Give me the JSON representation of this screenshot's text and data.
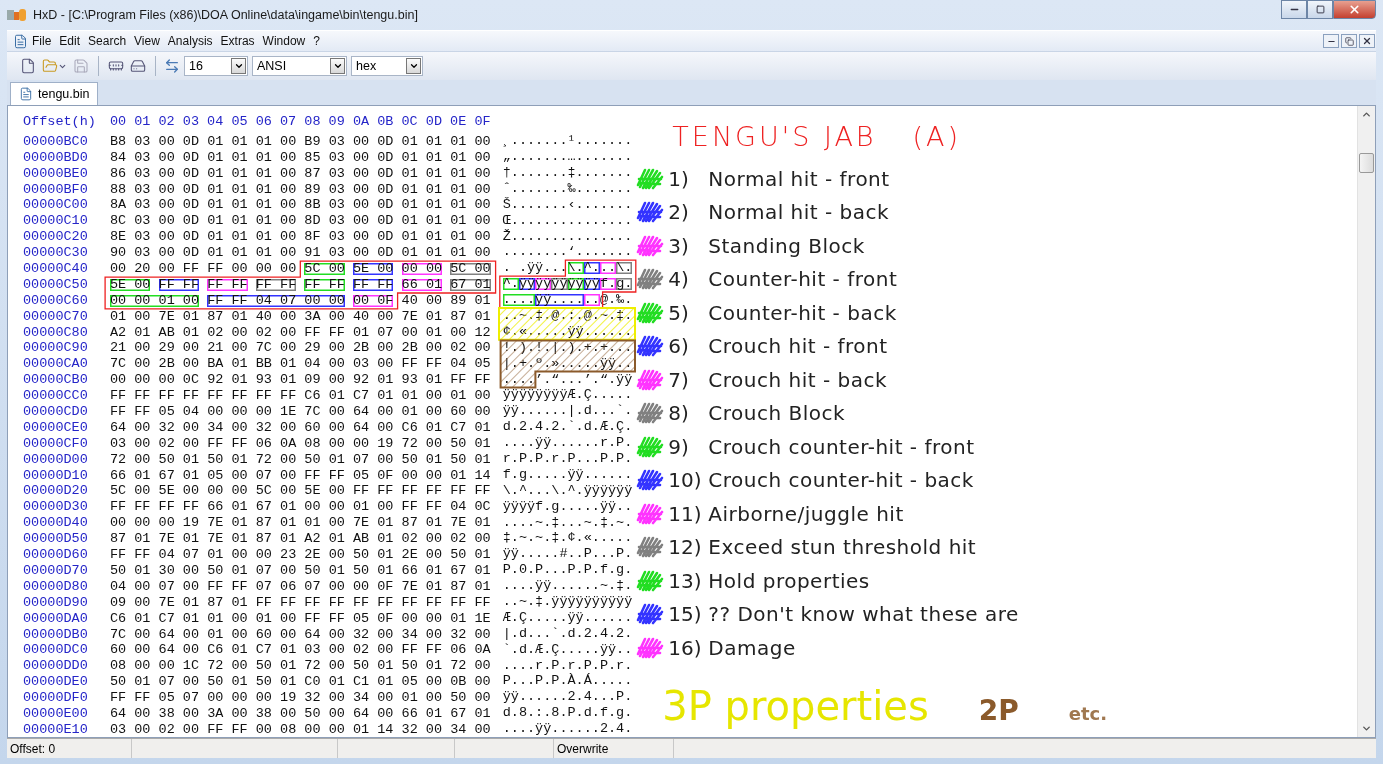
{
  "window": {
    "title": "HxD - [C:\\Program Files (x86)\\DOA Online\\data\\ingame\\bin\\tengu.bin]"
  },
  "menu": [
    "File",
    "Edit",
    "Search",
    "View",
    "Analysis",
    "Extras",
    "Window",
    "?"
  ],
  "toolbar": {
    "bytes_per_row": "16",
    "charset": "ANSI",
    "offset_base": "hex"
  },
  "tabs": [
    {
      "label": "tengu.bin",
      "selected": true
    }
  ],
  "editor": {
    "offset_header": "Offset(h)",
    "column_headers": [
      "00",
      "01",
      "02",
      "03",
      "04",
      "05",
      "06",
      "07",
      "08",
      "09",
      "0A",
      "0B",
      "0C",
      "0D",
      "0E",
      "0F"
    ],
    "rows": [
      {
        "offset": "00000BC0",
        "hex": [
          {
            "text": "B8 03 00 0D 01 01 01 00 B9 03 00 0D 01 01 01 00"
          }
        ],
        "ansi": [
          {
            "text": "¸.......¹......."
          }
        ]
      },
      {
        "offset": "00000BD0",
        "hex": [
          {
            "text": "84 03 00 0D 01 01 01 00 85 03 00 0D 01 01 01 00"
          }
        ],
        "ansi": [
          {
            "text": "„.......…......."
          }
        ]
      },
      {
        "offset": "00000BE0",
        "hex": [
          {
            "text": "86 03 00 0D 01 01 01 00 87 03 00 0D 01 01 01 00"
          }
        ],
        "ansi": [
          {
            "text": "†.......‡......."
          }
        ]
      },
      {
        "offset": "00000BF0",
        "hex": [
          {
            "text": "88 03 00 0D 01 01 01 00 89 03 00 0D 01 01 01 00"
          }
        ],
        "ansi": [
          {
            "text": "ˆ.......‰......."
          }
        ]
      },
      {
        "offset": "00000C00",
        "hex": [
          {
            "text": "8A 03 00 0D 01 01 01 00 8B 03 00 0D 01 01 01 00"
          }
        ],
        "ansi": [
          {
            "text": "Š.......‹......."
          }
        ]
      },
      {
        "offset": "00000C10",
        "hex": [
          {
            "text": "8C 03 00 0D 01 01 01 00 8D 03 00 0D 01 01 01 00"
          }
        ],
        "ansi": [
          {
            "text": "Œ..............."
          }
        ]
      },
      {
        "offset": "00000C20",
        "hex": [
          {
            "text": "8E 03 00 0D 01 01 01 00 8F 03 00 0D 01 01 01 00"
          }
        ],
        "ansi": [
          {
            "text": "Ž..............."
          }
        ]
      },
      {
        "offset": "00000C30",
        "hex": [
          {
            "text": "90 03 00 0D 01 01 01 00 91 03 00 0D 01 01 01 00"
          }
        ],
        "ansi": [
          {
            "text": "........‘......."
          }
        ]
      },
      {
        "offset": "00000C40",
        "hex": [
          {
            "text": "00 20 00 FF FF 00 00 00"
          },
          {
            "text": "5C 00",
            "color": "#22dd22"
          },
          {
            "text": "5E 00",
            "color": "#3333ff"
          },
          {
            "text": "00 00",
            "color": "#ff33ff"
          },
          {
            "text": "5C 00",
            "color": "#808080"
          }
        ],
        "ansi": [
          {
            "text": ". .ÿÿ..."
          },
          {
            "text": "\\.",
            "color": "#22dd22"
          },
          {
            "text": "^.",
            "color": "#3333ff"
          },
          {
            "text": "..",
            "color": "#ff33ff"
          },
          {
            "text": "\\.",
            "color": "#808080"
          }
        ]
      },
      {
        "offset": "00000C50",
        "hex": [
          {
            "text": "5E 00",
            "color": "#22dd22"
          },
          {
            "text": "FF FF",
            "color": "#3333ff"
          },
          {
            "text": "FF FF",
            "color": "#ff33ff"
          },
          {
            "text": "FF FF",
            "color": "#808080"
          },
          {
            "text": "FF FF",
            "color": "#22dd22"
          },
          {
            "text": "FF FF",
            "color": "#3333ff"
          },
          {
            "text": "66 01",
            "color": "#ff33ff"
          },
          {
            "text": "67 01",
            "color": "#808080"
          }
        ],
        "ansi": [
          {
            "text": "^.",
            "color": "#22dd22"
          },
          {
            "text": "ÿÿ",
            "color": "#3333ff"
          },
          {
            "text": "ÿÿ",
            "color": "#ff33ff"
          },
          {
            "text": "ÿÿ",
            "color": "#808080"
          },
          {
            "text": "ÿÿ",
            "color": "#22dd22"
          },
          {
            "text": "ÿÿ",
            "color": "#3333ff"
          },
          {
            "text": "f.",
            "color": "#ff33ff"
          },
          {
            "text": "g.",
            "color": "#808080"
          }
        ]
      },
      {
        "offset": "00000C60",
        "hex": [
          {
            "text": "00 00 01 00",
            "color": "#22dd22"
          },
          {
            "text": "FF FF 04 07 00 00",
            "color": "#3333ff"
          },
          {
            "text": "00 0F",
            "color": "#ff33ff"
          },
          {
            "text": "40 00 89 01"
          }
        ],
        "ansi": [
          {
            "text": "....",
            "color": "#22dd22"
          },
          {
            "text": "ÿÿ....",
            "color": "#3333ff"
          },
          {
            "text": "..",
            "color": "#ff33ff"
          },
          {
            "text": "@.‰."
          }
        ]
      },
      {
        "offset": "00000C70",
        "hex": [
          {
            "text": "01 00 7E 01 87 01 40 00 3A 00 40 00 7E 01 87 01"
          }
        ],
        "ansi": [
          {
            "text": "..~.‡.@.:.@.~.‡."
          }
        ]
      },
      {
        "offset": "00000C80",
        "hex": [
          {
            "text": "A2 01 AB 01 02 00 02 00 FF FF 01 07 00 01 00 12"
          }
        ],
        "ansi": [
          {
            "text": "¢.«.....ÿÿ......"
          }
        ]
      },
      {
        "offset": "00000C90",
        "hex": [
          {
            "text": "21 00 29 00 21 00 7C 00 29 00 2B 00 2B 00 02 00"
          }
        ],
        "ansi": [
          {
            "text": "!.).!.|.).+.+..."
          }
        ]
      },
      {
        "offset": "00000CA0",
        "hex": [
          {
            "text": "7C 00 2B 00 BA 01 BB 01 04 00 03 00 FF FF 04 05"
          }
        ],
        "ansi": [
          {
            "text": "|.+.º.».....ÿÿ.."
          }
        ]
      },
      {
        "offset": "00000CB0",
        "hex": [
          {
            "text": "00 00 00 0C 92 01 93 01 09 00 92 01 93 01 FF FF"
          }
        ],
        "ansi": [
          {
            "text": "....’.“...’.“.ÿÿ"
          }
        ]
      },
      {
        "offset": "00000CC0",
        "hex": [
          {
            "text": "FF FF FF FF FF FF FF FF C6 01 C7 01 01 00 01 00"
          }
        ],
        "ansi": [
          {
            "text": "ÿÿÿÿÿÿÿÿÆ.Ç....."
          }
        ]
      },
      {
        "offset": "00000CD0",
        "hex": [
          {
            "text": "FF FF 05 04 00 00 00 1E 7C 00 64 00 01 00 60 00"
          }
        ],
        "ansi": [
          {
            "text": "ÿÿ......|.d...`."
          }
        ]
      },
      {
        "offset": "00000CE0",
        "hex": [
          {
            "text": "64 00 32 00 34 00 32 00 60 00 64 00 C6 01 C7 01"
          }
        ],
        "ansi": [
          {
            "text": "d.2.4.2.`.d.Æ.Ç."
          }
        ]
      },
      {
        "offset": "00000CF0",
        "hex": [
          {
            "text": "03 00 02 00 FF FF 06 0A 08 00 00 19 72 00 50 01"
          }
        ],
        "ansi": [
          {
            "text": "....ÿÿ......r.P."
          }
        ]
      },
      {
        "offset": "00000D00",
        "hex": [
          {
            "text": "72 00 50 01 50 01 72 00 50 01 07 00 50 01 50 01"
          }
        ],
        "ansi": [
          {
            "text": "r.P.P.r.P...P.P."
          }
        ]
      },
      {
        "offset": "00000D10",
        "hex": [
          {
            "text": "66 01 67 01 05 00 07 00 FF FF 05 0F 00 00 01 14"
          }
        ],
        "ansi": [
          {
            "text": "f.g.....ÿÿ......"
          }
        ]
      },
      {
        "offset": "00000D20",
        "hex": [
          {
            "text": "5C 00 5E 00 00 00 5C 00 5E 00 FF FF FF FF FF FF"
          }
        ],
        "ansi": [
          {
            "text": "\\.^...\\.^.ÿÿÿÿÿÿ"
          }
        ]
      },
      {
        "offset": "00000D30",
        "hex": [
          {
            "text": "FF FF FF FF 66 01 67 01 00 00 01 00 FF FF 04 0C"
          }
        ],
        "ansi": [
          {
            "text": "ÿÿÿÿf.g.....ÿÿ.."
          }
        ]
      },
      {
        "offset": "00000D40",
        "hex": [
          {
            "text": "00 00 00 19 7E 01 87 01 01 00 7E 01 87 01 7E 01"
          }
        ],
        "ansi": [
          {
            "text": "....~.‡...~.‡.~."
          }
        ]
      },
      {
        "offset": "00000D50",
        "hex": [
          {
            "text": "87 01 7E 01 7E 01 87 01 A2 01 AB 01 02 00 02 00"
          }
        ],
        "ansi": [
          {
            "text": "‡.~.~.‡.¢.«....."
          }
        ]
      },
      {
        "offset": "00000D60",
        "hex": [
          {
            "text": "FF FF 04 07 01 00 00 23 2E 00 50 01 2E 00 50 01"
          }
        ],
        "ansi": [
          {
            "text": "ÿÿ.....#..P...P."
          }
        ]
      },
      {
        "offset": "00000D70",
        "hex": [
          {
            "text": "50 01 30 00 50 01 07 00 50 01 50 01 66 01 67 01"
          }
        ],
        "ansi": [
          {
            "text": "P.0.P...P.P.f.g."
          }
        ]
      },
      {
        "offset": "00000D80",
        "hex": [
          {
            "text": "04 00 07 00 FF FF 07 06 07 00 00 0F 7E 01 87 01"
          }
        ],
        "ansi": [
          {
            "text": "....ÿÿ......~.‡."
          }
        ]
      },
      {
        "offset": "00000D90",
        "hex": [
          {
            "text": "09 00 7E 01 87 01 FF FF FF FF FF FF FF FF FF FF"
          }
        ],
        "ansi": [
          {
            "text": "..~.‡.ÿÿÿÿÿÿÿÿÿÿ"
          }
        ]
      },
      {
        "offset": "00000DA0",
        "hex": [
          {
            "text": "C6 01 C7 01 01 00 01 00 FF FF 05 0F 00 00 01 1E"
          }
        ],
        "ansi": [
          {
            "text": "Æ.Ç.....ÿÿ......"
          }
        ]
      },
      {
        "offset": "00000DB0",
        "hex": [
          {
            "text": "7C 00 64 00 01 00 60 00 64 00 32 00 34 00 32 00"
          }
        ],
        "ansi": [
          {
            "text": "|.d...`.d.2.4.2."
          }
        ]
      },
      {
        "offset": "00000DC0",
        "hex": [
          {
            "text": "60 00 64 00 C6 01 C7 01 03 00 02 00 FF FF 06 0A"
          }
        ],
        "ansi": [
          {
            "text": "`.d.Æ.Ç.....ÿÿ.."
          }
        ]
      },
      {
        "offset": "00000DD0",
        "hex": [
          {
            "text": "08 00 00 1C 72 00 50 01 72 00 50 01 50 01 72 00"
          }
        ],
        "ansi": [
          {
            "text": "....r.P.r.P.P.r."
          }
        ]
      },
      {
        "offset": "00000DE0",
        "hex": [
          {
            "text": "50 01 07 00 50 01 50 01 C0 01 C1 01 05 00 0B 00"
          }
        ],
        "ansi": [
          {
            "text": "P...P.P.À.Á....."
          }
        ]
      },
      {
        "offset": "00000DF0",
        "hex": [
          {
            "text": "FF FF 05 07 00 00 00 19 32 00 34 00 01 00 50 00"
          }
        ],
        "ansi": [
          {
            "text": "ÿÿ......2.4...P."
          }
        ]
      },
      {
        "offset": "00000E00",
        "hex": [
          {
            "text": "64 00 38 00 3A 00 38 00 50 00 64 00 66 01 67 01"
          }
        ],
        "ansi": [
          {
            "text": "d.8.:.8.P.d.f.g."
          }
        ]
      },
      {
        "offset": "00000E10",
        "hex": [
          {
            "text": "03 00 02 00 FF FF 00 08 00 00 01 14 32 00 34 00"
          }
        ],
        "ansi": [
          {
            "text": "....ÿÿ......2.4."
          }
        ]
      }
    ]
  },
  "annotations": {
    "title": "TENGU'S JAB",
    "variant": "(A)",
    "legend": [
      {
        "number": "1)",
        "text": "Normal hit - front",
        "color": "#22dd22"
      },
      {
        "number": "2)",
        "text": "Normal hit - back",
        "color": "#3333ff"
      },
      {
        "number": "3)",
        "text": "Standing Block",
        "color": "#ff33ff"
      },
      {
        "number": "4)",
        "text": "Counter-hit - front",
        "color": "#808080"
      },
      {
        "number": "5)",
        "text": "Counter-hit - back",
        "color": "#22dd22"
      },
      {
        "number": "6)",
        "text": "Crouch hit - front",
        "color": "#3333ff"
      },
      {
        "number": "7)",
        "text": "Crouch hit - back",
        "color": "#ff33ff"
      },
      {
        "number": "8)",
        "text": "Crouch Block",
        "color": "#808080"
      },
      {
        "number": "9)",
        "text": "Crouch counter-hit - front",
        "color": "#22dd22"
      },
      {
        "number": "10)",
        "text": "Crouch counter-hit - back",
        "color": "#3333ff"
      },
      {
        "number": "11)",
        "text": "Airborne/juggle hit",
        "color": "#ff33ff"
      },
      {
        "number": "12)",
        "text": "Exceed stun threshold hit",
        "color": "#808080"
      },
      {
        "number": "13)",
        "text": "Hold properties",
        "color": "#22dd22"
      },
      {
        "number": "15)",
        "text": "?? Don't know what these are",
        "color": "#3333ff"
      },
      {
        "number": "16)",
        "text": "Damage",
        "color": "#ff33ff"
      }
    ],
    "notes": [
      {
        "text": "3P properties",
        "color": "#e6e600"
      },
      {
        "text": "2P",
        "color": "#8b5a2b"
      },
      {
        "text": "etc.",
        "color": "#a07850"
      }
    ]
  },
  "status_bar": {
    "offset": "Offset: 0",
    "mode": "Overwrite"
  }
}
